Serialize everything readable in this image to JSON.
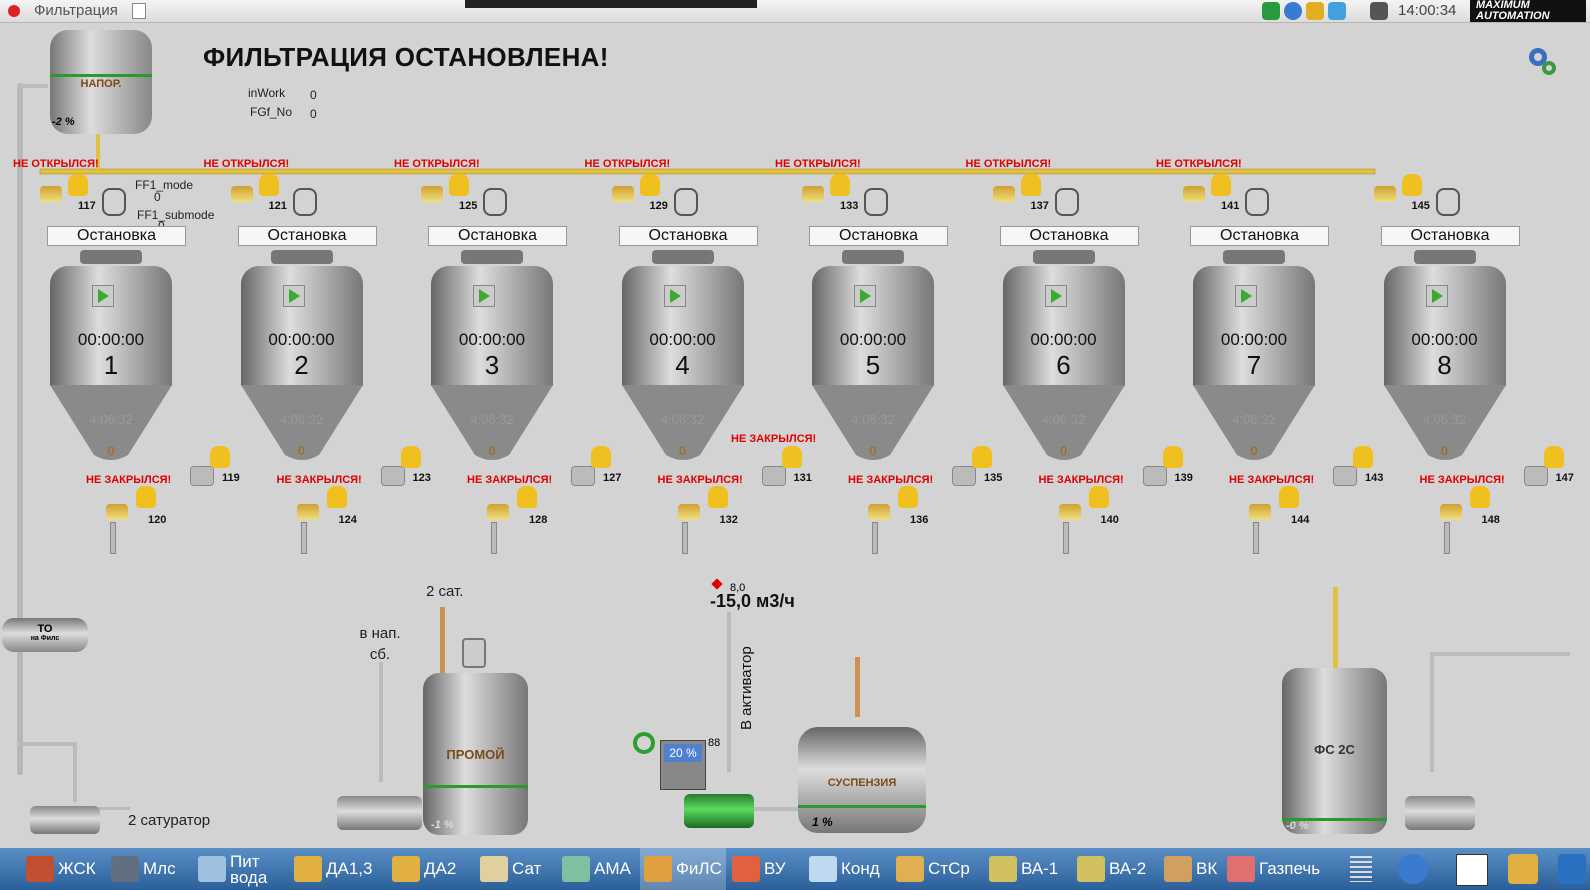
{
  "window": {
    "title": "Фильтрация",
    "clock": "14:00:34",
    "logo": "MAXIMUM AUTOMATION"
  },
  "main_title": "ФИЛЬТРАЦИЯ ОСТАНОВЛЕНА!",
  "params": {
    "inwork_label": "inWork",
    "inwork_value": "0",
    "fgf_label": "FGf_No",
    "fgf_value": "0",
    "ff1_mode_label": "FF1_mode",
    "ff1_mode_value": "0",
    "ff1_submode_label": "FF1_submode",
    "ff1_submode_value": "0"
  },
  "supply_tank": {
    "label": "НАПОР.",
    "level": "-2 %"
  },
  "filters": [
    {
      "id": "1",
      "status": "Остановка",
      "timer": "00:00:00",
      "time2": "4:06:32",
      "bottom": "0",
      "top_valve": "117",
      "side_valve": "119",
      "bottom_valve": "120",
      "top_alarm": "НЕ ОТКРЫЛСЯ!",
      "bottom_alarm": "НЕ ЗАКРЫЛСЯ!"
    },
    {
      "id": "2",
      "status": "Остановка",
      "timer": "00:00:00",
      "time2": "4:06:32",
      "bottom": "0",
      "top_valve": "121",
      "side_valve": "123",
      "bottom_valve": "124",
      "top_alarm": "НЕ ОТКРЫЛСЯ!",
      "bottom_alarm": "НЕ ЗАКРЫЛСЯ!"
    },
    {
      "id": "3",
      "status": "Остановка",
      "timer": "00:00:00",
      "time2": "4:06:32",
      "bottom": "0",
      "top_valve": "125",
      "side_valve": "127",
      "bottom_valve": "128",
      "top_alarm": "НЕ ОТКРЫЛСЯ!",
      "bottom_alarm": "НЕ ЗАКРЫЛСЯ!"
    },
    {
      "id": "4",
      "status": "Остановка",
      "timer": "00:00:00",
      "time2": "4:06:32",
      "bottom": "0",
      "top_valve": "129",
      "side_valve": "131",
      "bottom_valve": "132",
      "top_alarm": "НЕ ОТКРЫЛСЯ!",
      "bottom_alarm": "НЕ ЗАКРЫЛСЯ!"
    },
    {
      "id": "5",
      "status": "Остановка",
      "timer": "00:00:00",
      "time2": "4:06:32",
      "bottom": "0",
      "top_valve": "133",
      "side_valve": "135",
      "bottom_valve": "136",
      "top_alarm": "НЕ ОТКРЫЛСЯ!",
      "bottom_alarm": "НЕ ЗАКРЫЛСЯ!"
    },
    {
      "id": "6",
      "status": "Остановка",
      "timer": "00:00:00",
      "time2": "4:06:32",
      "bottom": "0",
      "top_valve": "137",
      "side_valve": "139",
      "bottom_valve": "140",
      "top_alarm": "НЕ ОТКРЫЛСЯ!",
      "bottom_alarm": "НЕ ЗАКРЫЛСЯ!"
    },
    {
      "id": "7",
      "status": "Остановка",
      "timer": "00:00:00",
      "time2": "4:06:32",
      "bottom": "0",
      "top_valve": "141",
      "side_valve": "143",
      "bottom_valve": "144",
      "top_alarm": "НЕ ОТКРЫЛСЯ!",
      "bottom_alarm": "НЕ ЗАКРЫЛСЯ!"
    },
    {
      "id": "8",
      "status": "Остановка",
      "timer": "00:00:00",
      "time2": "4:06:32",
      "bottom": "0",
      "top_valve": "145",
      "side_valve": "147",
      "bottom_valve": "148",
      "top_alarm": "",
      "bottom_alarm": "НЕ ЗАКРЫЛСЯ!"
    }
  ],
  "valve_131_alarm": "НЕ ЗАКРЫЛСЯ!",
  "heat_exchanger": {
    "label": "ТО",
    "sublabel": "на Филс"
  },
  "saturator_label": "2 сатуратор",
  "to_supply_label": "в нап. сб.",
  "sat2_label": "2 сат.",
  "wash_tank": {
    "label": "ПРОМОЙ",
    "level": "-1 %"
  },
  "flow": {
    "setpoint": "8,0",
    "value": "-15,0 м3/ч"
  },
  "to_activator": "В активатор",
  "pump_speed": {
    "percent": "20 %",
    "value": "88"
  },
  "suspension_tank": {
    "label": "СУСПЕНЗИЯ",
    "level": "1 %"
  },
  "fs_tank": {
    "label": "ФС 2С",
    "level": "-0 %"
  },
  "taskbar": [
    {
      "label": "ЖСК",
      "color": "#c05030"
    },
    {
      "label": "Млс",
      "color": "#607080"
    },
    {
      "label": "Пит вода",
      "color": "#a0c0e0"
    },
    {
      "label": "ДА1,3",
      "color": "#e0b040"
    },
    {
      "label": "ДА2",
      "color": "#e0b040"
    },
    {
      "label": "Сат",
      "color": "#e0d0a0"
    },
    {
      "label": "АМА",
      "color": "#80c0a0"
    },
    {
      "label": "ФиЛС",
      "color": "#e0a040"
    },
    {
      "label": "ВУ",
      "color": "#e06040"
    },
    {
      "label": "Конд",
      "color": "#c0d8f0"
    },
    {
      "label": "СтСр",
      "color": "#e0b050"
    },
    {
      "label": "ВА-1",
      "color": "#d0c060"
    },
    {
      "label": "ВА-2",
      "color": "#d0c060"
    },
    {
      "label": "ВК",
      "color": "#d0a060"
    },
    {
      "label": "Газпечь",
      "color": "#e07070"
    }
  ]
}
